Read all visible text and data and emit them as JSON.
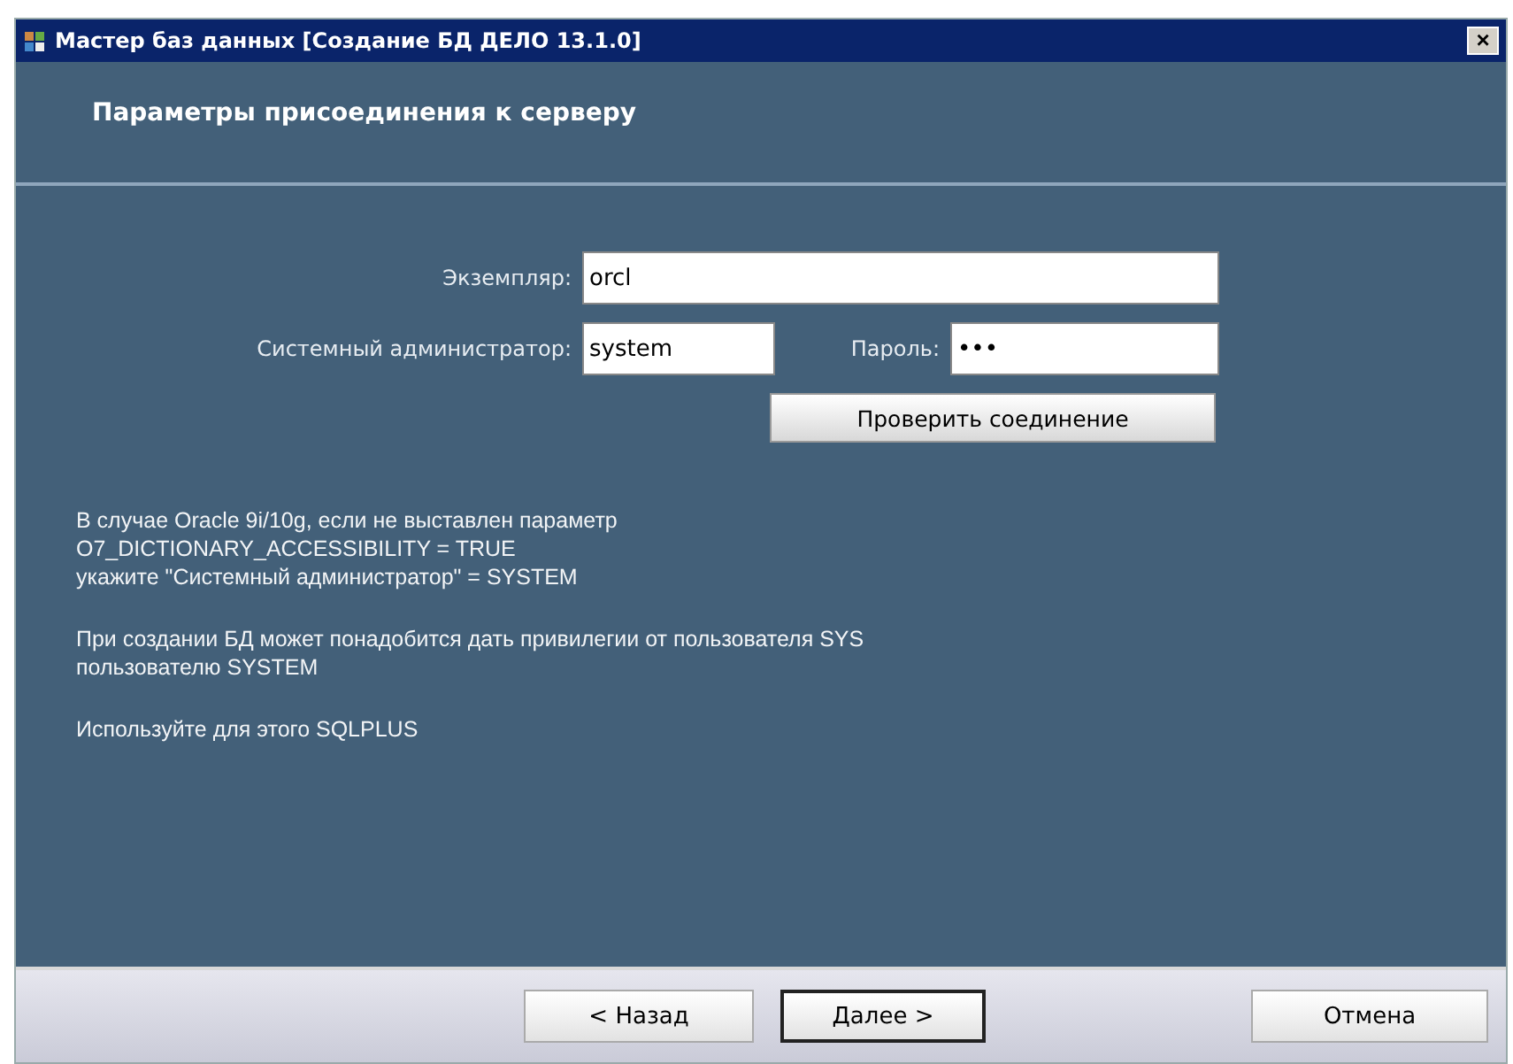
{
  "window": {
    "title": "Мастер баз данных [Создание БД ДЕЛО 13.1.0]",
    "close": "×"
  },
  "header": {
    "title": "Параметры присоединения к серверу"
  },
  "form": {
    "instance": {
      "label": "Экземпляр:",
      "value": "orcl"
    },
    "admin": {
      "label": "Системный администратор:",
      "value": "system"
    },
    "password": {
      "label": "Пароль:",
      "value": "•••"
    },
    "check_button": "Проверить соединение"
  },
  "info": [
    {
      "lines": [
        "В случае Oracle 9i/10g, если не выставлен параметр",
        "O7_DICTIONARY_ACCESSIBILITY = TRUE",
        "укажите \"Системный администратор\" = SYSTEM"
      ]
    },
    {
      "lines": [
        "При создании БД может понадобится дать привилегии от пользователя SYS",
        "пользователю SYSTEM"
      ]
    },
    {
      "lines": [
        "Используйте для этого SQLPLUS"
      ]
    }
  ],
  "buttons": [
    {
      "label": "< Назад",
      "default": false
    },
    {
      "label": "Далее >",
      "default": true
    },
    {
      "label": "Отмена",
      "default": false
    }
  ]
}
